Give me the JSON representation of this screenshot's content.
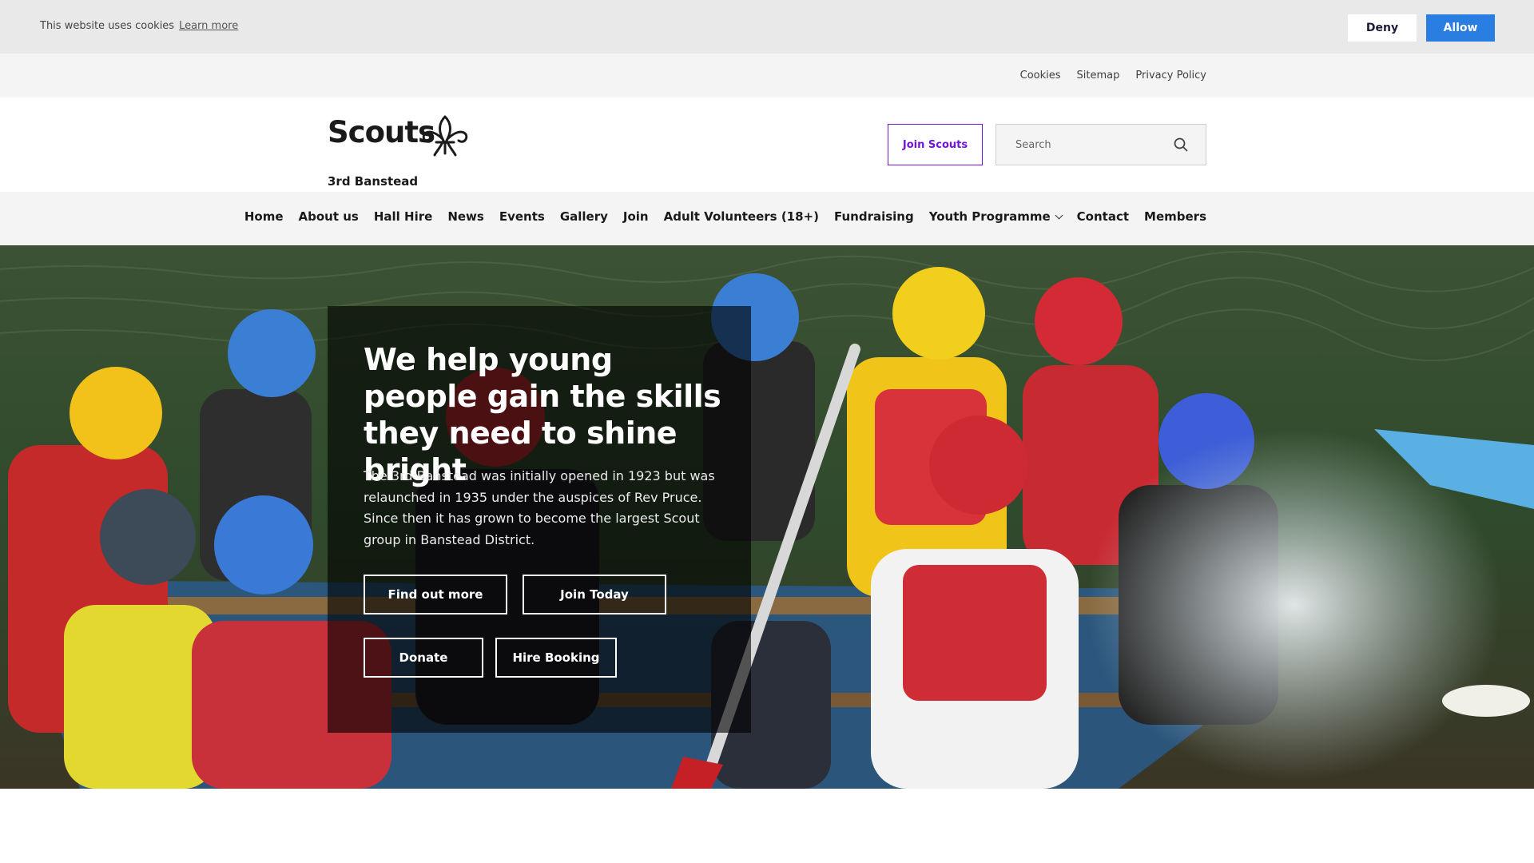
{
  "cookie_bar": {
    "message": "This website uses cookies",
    "learn_more": "Learn more",
    "deny": "Deny",
    "allow": "Allow"
  },
  "utility_links": [
    "Cookies",
    "Sitemap",
    "Privacy Policy"
  ],
  "header": {
    "logo_word": "Scouts",
    "logo_sub": "3rd Banstead",
    "join_button": "Join Scouts",
    "search_placeholder": "Search"
  },
  "nav": {
    "items": [
      "Home",
      "About us",
      "Hall Hire",
      "News",
      "Events",
      "Gallery",
      "Join",
      "Adult Volunteers (18+)",
      "Fundraising",
      "Youth Programme",
      "Contact",
      "Members"
    ]
  },
  "hero": {
    "title": "We help young people gain the skills they need to shine bright",
    "text": "The 3rd Banstead was initially opened in 1923 but was relaunched in 1935 under the auspices of Rev Pruce. Since then it has grown to become the largest Scout group in Banstead District.",
    "buttons": {
      "find": "Find out more",
      "join": "Join Today",
      "donate": "Donate",
      "hire": "Hire Booking"
    }
  },
  "colors": {
    "brand_purple": "#7413dc",
    "allow_blue": "#2a7de1",
    "bar_grey": "#f4f4f4"
  }
}
